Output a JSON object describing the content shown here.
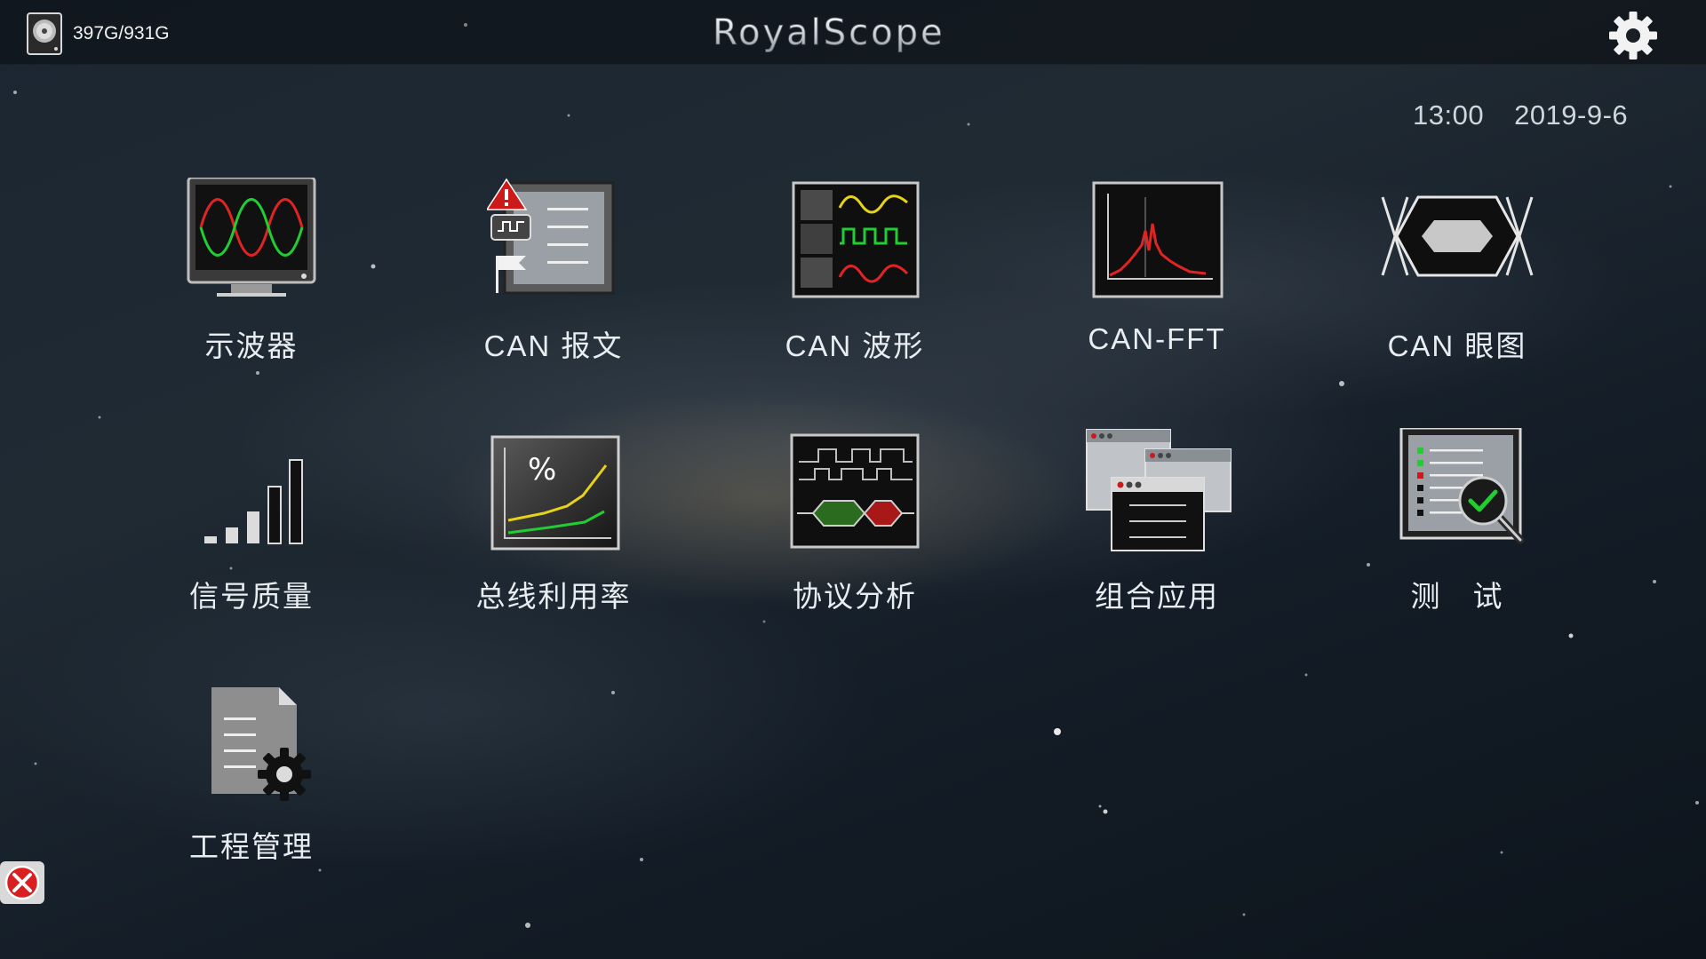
{
  "window": {
    "brand": "RoyalScope"
  },
  "status": {
    "disk_usage": "397G/931G",
    "time": "13:00",
    "date": "2019-9-6"
  },
  "icons": {
    "disk": "hard-disk-icon",
    "settings": "gear-icon",
    "close": "close-icon"
  },
  "apps": [
    {
      "id": "oscilloscope",
      "label": "示波器",
      "icon": "oscilloscope-icon"
    },
    {
      "id": "can-message",
      "label": "CAN 报文",
      "icon": "can-message-icon"
    },
    {
      "id": "can-waveform",
      "label": "CAN 波形",
      "icon": "can-waveform-icon"
    },
    {
      "id": "can-fft",
      "label": "CAN-FFT",
      "icon": "fft-spectrum-icon"
    },
    {
      "id": "can-eye",
      "label": "CAN 眼图",
      "icon": "eye-diagram-icon"
    },
    {
      "id": "signal-quality",
      "label": "信号质量",
      "icon": "signal-bars-icon"
    },
    {
      "id": "bus-utilization",
      "label": "总线利用率",
      "icon": "utilization-chart-icon"
    },
    {
      "id": "protocol-analysis",
      "label": "协议分析",
      "icon": "protocol-decode-icon"
    },
    {
      "id": "combined-app",
      "label": "组合应用",
      "icon": "stacked-windows-icon"
    },
    {
      "id": "test",
      "label": "测　试",
      "icon": "checklist-magnifier-icon"
    },
    {
      "id": "project-management",
      "label": "工程管理",
      "icon": "document-gear-icon"
    }
  ],
  "colors": {
    "accent_red": "#cc1a1a",
    "trace_green": "#22cc33",
    "trace_yellow": "#e6d21a",
    "label_text": "#e8edf1"
  }
}
